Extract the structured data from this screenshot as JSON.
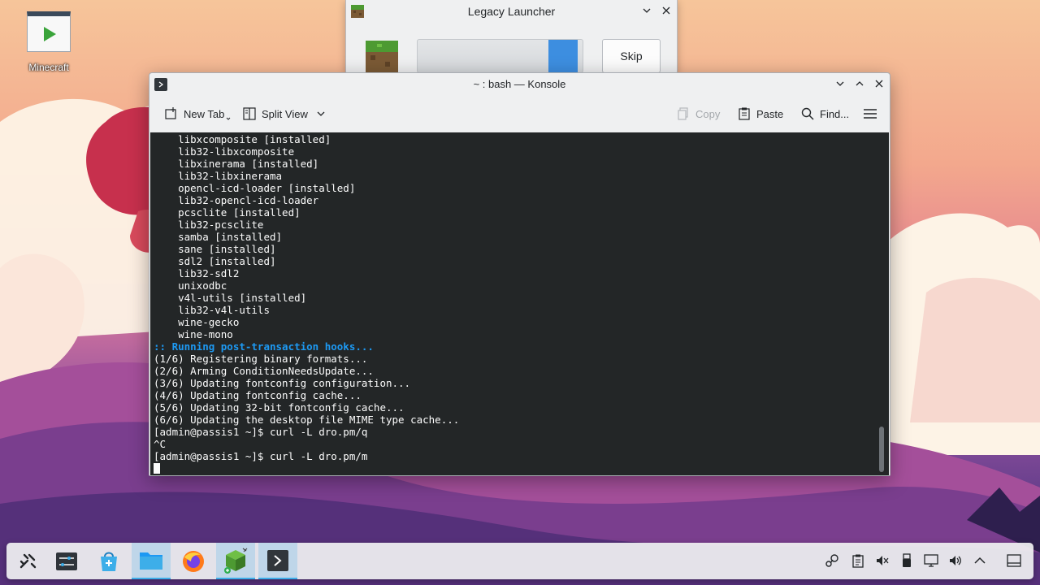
{
  "desktop": {
    "icons": [
      {
        "label": "Minecraft"
      }
    ]
  },
  "launcher": {
    "title": "Legacy Launcher",
    "skip_label": "Skip",
    "progress": 0.97
  },
  "konsole": {
    "title": "~ : bash — Konsole",
    "toolbar": {
      "new_tab": "New Tab",
      "split_view": "Split View",
      "copy": "Copy",
      "paste": "Paste",
      "find": "Find..."
    },
    "lines": [
      "    libxcomposite [installed]",
      "    lib32-libxcomposite",
      "    libxinerama [installed]",
      "    lib32-libxinerama",
      "    opencl-icd-loader [installed]",
      "    lib32-opencl-icd-loader",
      "    pcsclite [installed]",
      "    lib32-pcsclite",
      "    samba [installed]",
      "    sane [installed]",
      "    sdl2 [installed]",
      "    lib32-sdl2",
      "    unixodbc",
      "    v4l-utils [installed]",
      "    lib32-v4l-utils",
      "    wine-gecko",
      "    wine-mono",
      ":: Running post-transaction hooks...",
      "(1/6) Registering binary formats...",
      "(2/6) Arming ConditionNeedsUpdate...",
      "(3/6) Updating fontconfig configuration...",
      "(4/6) Updating fontconfig cache...",
      "(5/6) Updating 32-bit fontconfig cache...",
      "(6/6) Updating the desktop file MIME type cache...",
      "[admin@passis1 ~]$ curl -L dro.pm/q",
      "^C",
      "[admin@passis1 ~]$ curl -L dro.pm/m"
    ]
  },
  "taskbar": {
    "tasks": [
      {
        "icon": "application-launcher-icon"
      },
      {
        "icon": "system-settings-icon"
      },
      {
        "icon": "discover-store-icon"
      },
      {
        "icon": "file-manager-icon"
      },
      {
        "icon": "firefox-icon"
      },
      {
        "icon": "minecraft-launcher-icon"
      },
      {
        "icon": "konsole-icon"
      }
    ],
    "tray": [
      "steam-icon",
      "clipboard-icon",
      "volume-muted-icon",
      "usb-device-icon",
      "display-icon",
      "volume-icon",
      "tray-expand-icon",
      "show-desktop-icon"
    ]
  },
  "colors": {
    "accent": "#3daee9",
    "terminal_bg": "#232627",
    "terminal_fg": "#fcfcfc",
    "terminal_hook": "#1d99f3"
  }
}
